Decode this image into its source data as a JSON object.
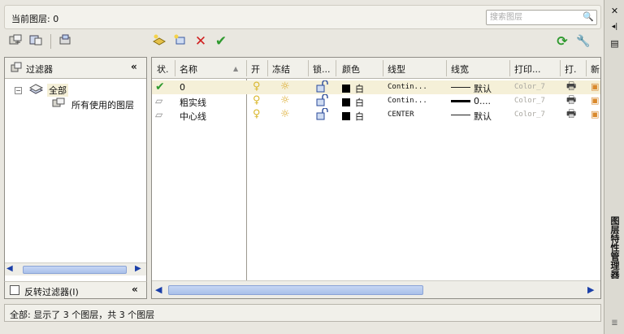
{
  "current_layer": {
    "label": "当前图层: 0"
  },
  "search": {
    "placeholder": "搜索图层"
  },
  "toolbar": {
    "new_property_filter_icon": "property-filter-icon",
    "new_group_filter_icon": "group-filter-icon",
    "state_manager_icon": "layer-state-manager-icon",
    "new_layer_icon": "new-layer-icon",
    "new_vp_frozen_layer_icon": "new-vp-frozen-layer-icon",
    "delete_layer_icon": "delete-layer-icon",
    "set_current_icon": "set-current-icon",
    "refresh_icon": "refresh-icon",
    "settings_icon": "settings-icon"
  },
  "filter_panel": {
    "header_label": "过滤器",
    "collapse_glyph": "«",
    "tree": {
      "all_label": "全部",
      "all_expander": "−",
      "used_label": "所有使用的图层"
    },
    "invert_label": "反转过滤器(I)",
    "footer_collapse_glyph": "«"
  },
  "grid": {
    "columns": {
      "status": "状.",
      "name": "名称",
      "on": "开",
      "freeze": "冻结",
      "lock": "锁...",
      "color": "颜色",
      "linetype": "线型",
      "lineweight": "线宽",
      "plotstyle": "打印...",
      "plot": "打.",
      "newvp": "新"
    },
    "rows": [
      {
        "status": "current",
        "name": "0",
        "color_name": "白",
        "color": "#000000",
        "linetype": "Contin...",
        "lineweight": "默认",
        "plotstyle": "Color_7"
      },
      {
        "status": "normal",
        "name": "粗实线",
        "color_name": "白",
        "color": "#000000",
        "linetype": "Contin...",
        "lineweight": "0....",
        "plotstyle": "Color_7"
      },
      {
        "status": "normal",
        "name": "中心线",
        "color_name": "白",
        "color": "#000000",
        "linetype": "CENTER",
        "lineweight": "默认",
        "plotstyle": "Color_7"
      }
    ]
  },
  "status_bar": {
    "text": "全部: 显示了 3 个图层，共 3 个图层"
  },
  "palette": {
    "title": "图层特性管理器",
    "close_glyph": "✕",
    "autohide_glyph": "◂|",
    "properties_glyph": "▤"
  },
  "colors": {
    "current_row": "#f5f0d8",
    "check_green": "#2f9a2f",
    "delete_red": "#d02020",
    "scroll_blue": "#1b3fa8"
  }
}
